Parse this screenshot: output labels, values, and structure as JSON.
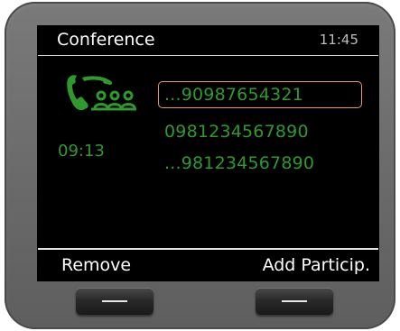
{
  "header": {
    "title": "Conference",
    "time": "11:45"
  },
  "call": {
    "icon": "conference-call-icon",
    "duration": "09:13",
    "icon_color": "#2e9a2e"
  },
  "participants": [
    {
      "number": "...90987654321",
      "selected": true
    },
    {
      "number": "0981234567890",
      "selected": false
    },
    {
      "number": "...981234567890",
      "selected": false
    }
  ],
  "softkeys": {
    "left_label": "Remove",
    "right_label": "Add Particip."
  },
  "colors": {
    "accent_text": "#2e9a2e",
    "selection_border": "#e6995a",
    "screen_bg": "#000000"
  }
}
